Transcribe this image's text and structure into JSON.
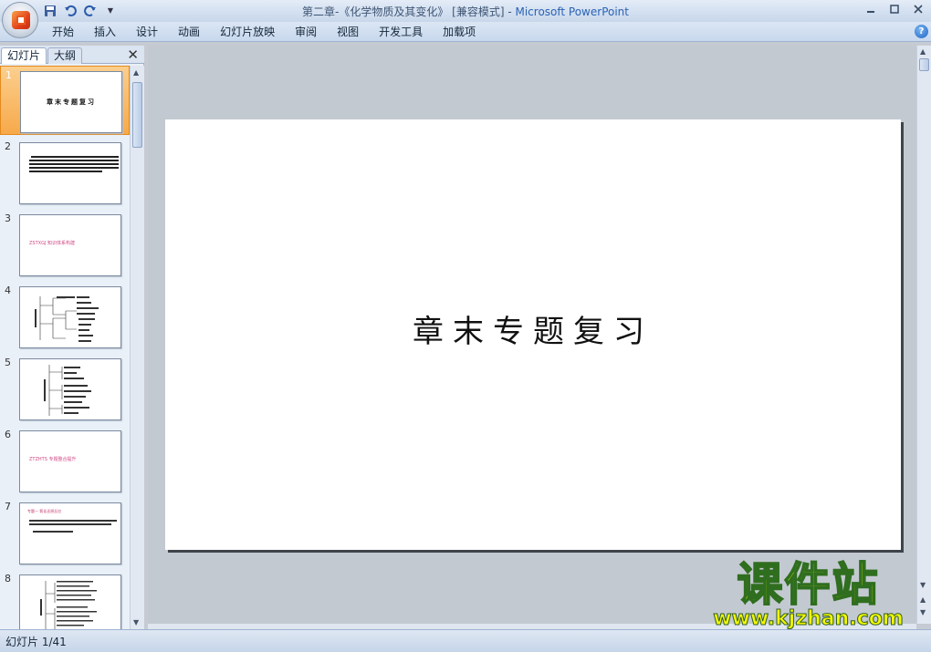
{
  "window": {
    "title_doc": "第二章-《化学物质及其变化》 [兼容模式] - ",
    "title_app": "Microsoft PowerPoint",
    "controls": [
      "minimize-icon",
      "maximize-icon",
      "close-icon"
    ]
  },
  "quick_access": [
    "save-icon",
    "undo-icon",
    "redo-icon",
    "customize-icon"
  ],
  "ribbon": {
    "tabs": [
      "开始",
      "插入",
      "设计",
      "动画",
      "幻灯片放映",
      "审阅",
      "视图",
      "开发工具",
      "加载项"
    ],
    "help_label": "?"
  },
  "panel": {
    "tab_slides": "幻灯片",
    "tab_outline": "大纲",
    "close_label": "✕",
    "thumbnails": [
      {
        "num": "1",
        "title": "章末专题复习",
        "selected": true
      },
      {
        "num": "2",
        "title": "",
        "selected": false
      },
      {
        "num": "3",
        "title": "ZSTXGJ 知识体系构建",
        "selected": false
      },
      {
        "num": "4",
        "title": "",
        "selected": false
      },
      {
        "num": "5",
        "title": "",
        "selected": false
      },
      {
        "num": "6",
        "title": "ZTZHTS 专题整合提升",
        "selected": false
      },
      {
        "num": "7",
        "title": "专题一 氧化还原反应",
        "selected": false
      },
      {
        "num": "8",
        "title": "",
        "selected": false
      }
    ]
  },
  "slide": {
    "title": "章末专题复习"
  },
  "status": {
    "slide_counter": "幻灯片 1/41"
  },
  "watermark": {
    "cn": "课件站",
    "en": "www.kjzhan.com"
  }
}
